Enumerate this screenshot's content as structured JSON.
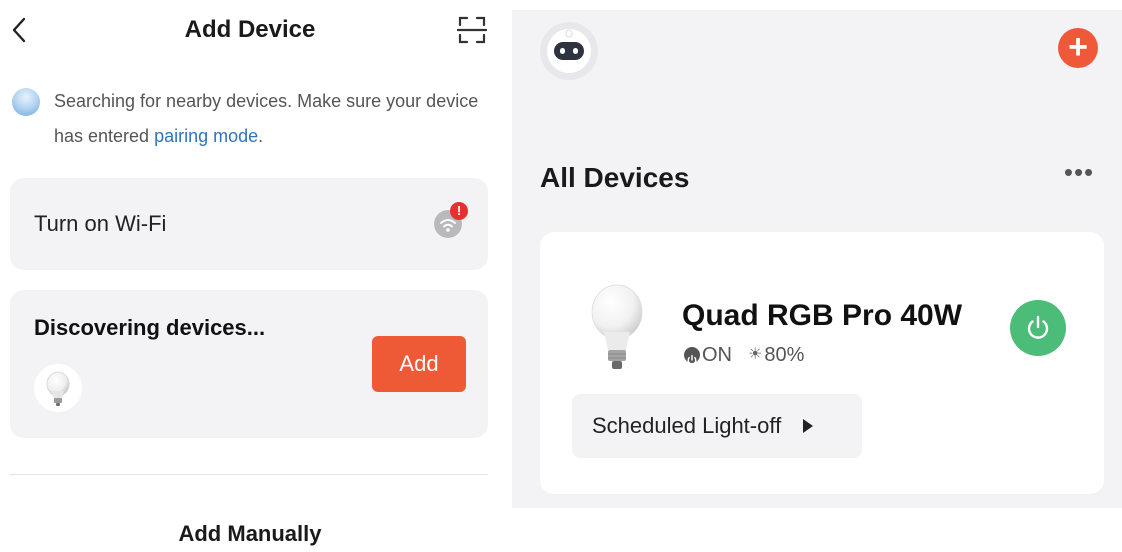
{
  "add_device_screen": {
    "title": "Add Device",
    "search_message": {
      "text_before": "Searching for nearby devices. Make sure your device has entered ",
      "link": "pairing mode",
      "text_after": "."
    },
    "wifi_card": {
      "label": "Turn on Wi-Fi",
      "alert_badge": "!",
      "icon": "wifi-icon"
    },
    "discover_card": {
      "title": "Discovering devices...",
      "add_button_label": "Add",
      "icon": "light-bulb-icon"
    },
    "add_manually_label": "Add Manually",
    "icons": {
      "back": "chevron-left-icon",
      "scan": "scan-icon"
    }
  },
  "home_screen": {
    "plus_label": "+",
    "section_title": "All Devices",
    "more_label": "•••",
    "device": {
      "name": "Quad RGB Pro 40W",
      "state": "ON",
      "brightness": "80%",
      "schedule_label": "Scheduled Light-off",
      "icon": "light-bulb-icon"
    },
    "colors": {
      "accent_orange": "#f0583a",
      "power_green": "#4cbc79",
      "link_blue": "#2f74c0"
    }
  }
}
